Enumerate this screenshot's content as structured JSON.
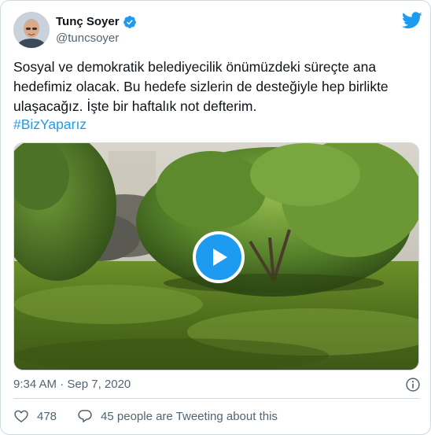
{
  "author": {
    "name": "Tunç Soyer",
    "handle": "@tuncsoyer",
    "verified": true
  },
  "tweet": {
    "text": "Sosyal ve demokratik belediyecilik önümüzdeki süreçte ana hedefimiz olacak. Bu hedefe sizlerin de desteğiyle hep birlikte ulaşacağız. İşte bir haftalık not defterim.",
    "hashtag": "#BizYaparız"
  },
  "media": {
    "type": "video",
    "play_icon": "play-icon"
  },
  "meta": {
    "timestamp": "9:34 AM · Sep 7, 2020"
  },
  "actions": {
    "like_count": "478",
    "reply_text": "45 people are Tweeting about this"
  },
  "colors": {
    "accent": "#1d9bf0",
    "text": "#0f1419",
    "secondary": "#536471",
    "border": "#cfd9de"
  },
  "icons": [
    "verified-badge-icon",
    "twitter-logo-icon",
    "play-icon",
    "info-icon",
    "heart-icon",
    "reply-bubble-icon"
  ]
}
